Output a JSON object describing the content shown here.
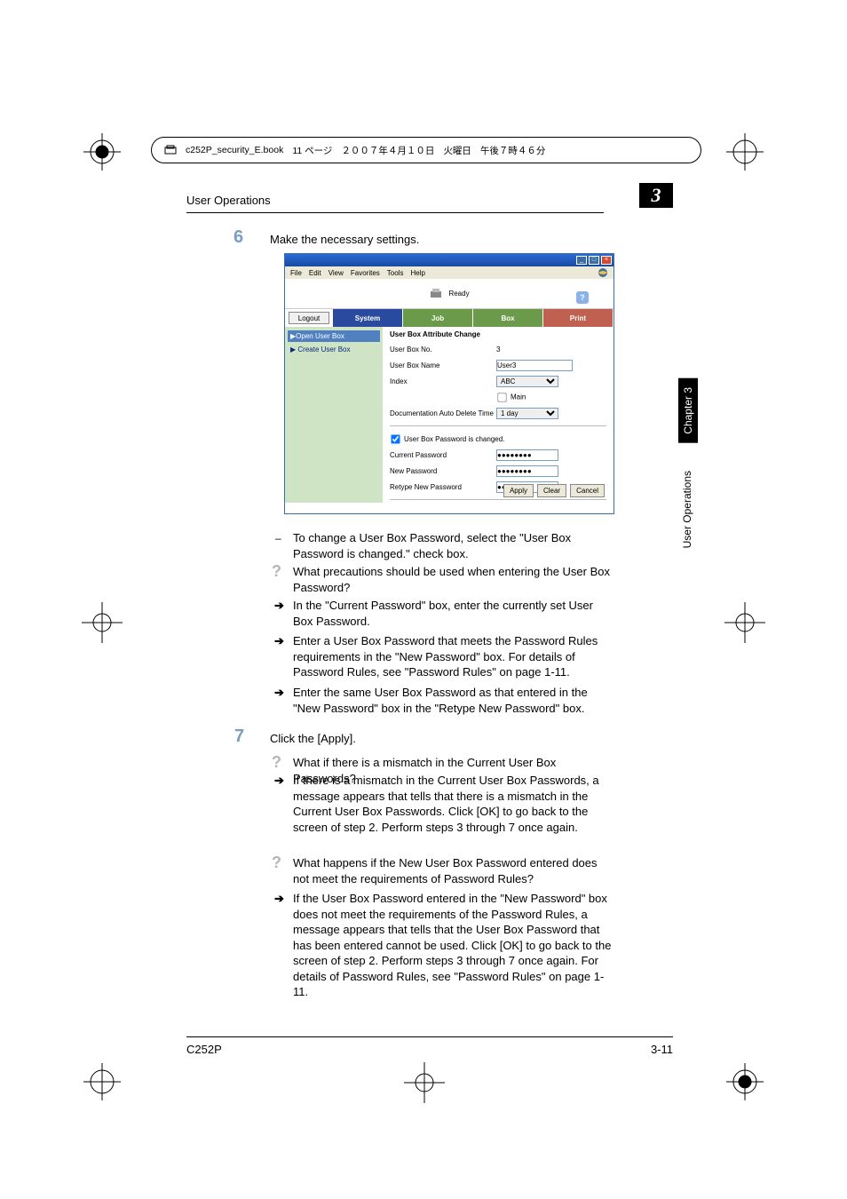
{
  "header_bar": {
    "filename": "c252P_security_E.book",
    "page_jp": "11 ページ",
    "date_jp": "２００７年４月１０日",
    "weekday_jp": "火曜日",
    "time_jp": "午後７時４６分"
  },
  "page": {
    "section_title": "User Operations",
    "chapter_num": "3",
    "side_chapter": "Chapter 3",
    "side_section": "User Operations",
    "footer_model": "C252P",
    "footer_page": "3-11"
  },
  "steps": {
    "six": {
      "num": "6",
      "text": "Make the necessary settings."
    },
    "seven": {
      "num": "7",
      "text": "Click the [Apply]."
    }
  },
  "app": {
    "menus": [
      "File",
      "Edit",
      "View",
      "Favorites",
      "Tools",
      "Help"
    ],
    "ready": "Ready",
    "help_glyph": "?",
    "logout": "Logout",
    "tabs": {
      "system": "System",
      "job": "Job",
      "box": "Box",
      "print": "Print"
    },
    "nav": {
      "open": "▶Open User Box",
      "create": "▶ Create User Box"
    },
    "form": {
      "title": "User Box Attribute Change",
      "boxno_label": "User Box No.",
      "boxno_value": "3",
      "boxname_label": "User Box Name",
      "boxname_value": "User3",
      "index_label": "Index",
      "index_value": "ABC",
      "main_label": "Main",
      "autodel_label": "Documentation Auto Delete Time",
      "autodel_value": "1 day",
      "pwchange_label": "User Box Password is changed.",
      "cur_label": "Current Password",
      "new_label": "New Password",
      "retype_label": "Retype New Password",
      "pw_mask": "●●●●●●●●",
      "apply": "Apply",
      "clear": "Clear",
      "cancel": "Cancel"
    }
  },
  "notes": {
    "n1": "To change a User Box Password, select the \"User Box Password is changed.\" check box.",
    "q1": "What precautions should be used when entering the User Box Password?",
    "a1": "In the \"Current Password\" box, enter the currently set User Box Password.",
    "a2": "Enter a User Box Password that meets the Password Rules requirements in the \"New Password\" box. For details of Password Rules, see \"Password Rules\" on page 1-11.",
    "a3": "Enter the same User Box Password as that entered in the \"New Password\" box in the \"Retype New Password\" box.",
    "q2": "What if there is a mismatch in the Current User Box Passwords?",
    "a4": "If there is a mismatch in the Current User Box Passwords, a message appears that tells that there is a mismatch in the Current User Box Passwords. Click [OK] to go back to the screen of step 2. Perform steps 3 through 7 once again.",
    "q3": "What happens if the New User Box Password entered does not meet the requirements of Password Rules?",
    "a5": "If the User Box Password entered in the \"New Password\" box does not meet the requirements of the Password Rules, a message appears that tells that the User Box Password that has been entered cannot be used. Click [OK] to go back to the screen of step 2. Perform steps 3 through 7 once again. For details of Password Rules, see \"Password Rules\" on page 1-11."
  }
}
